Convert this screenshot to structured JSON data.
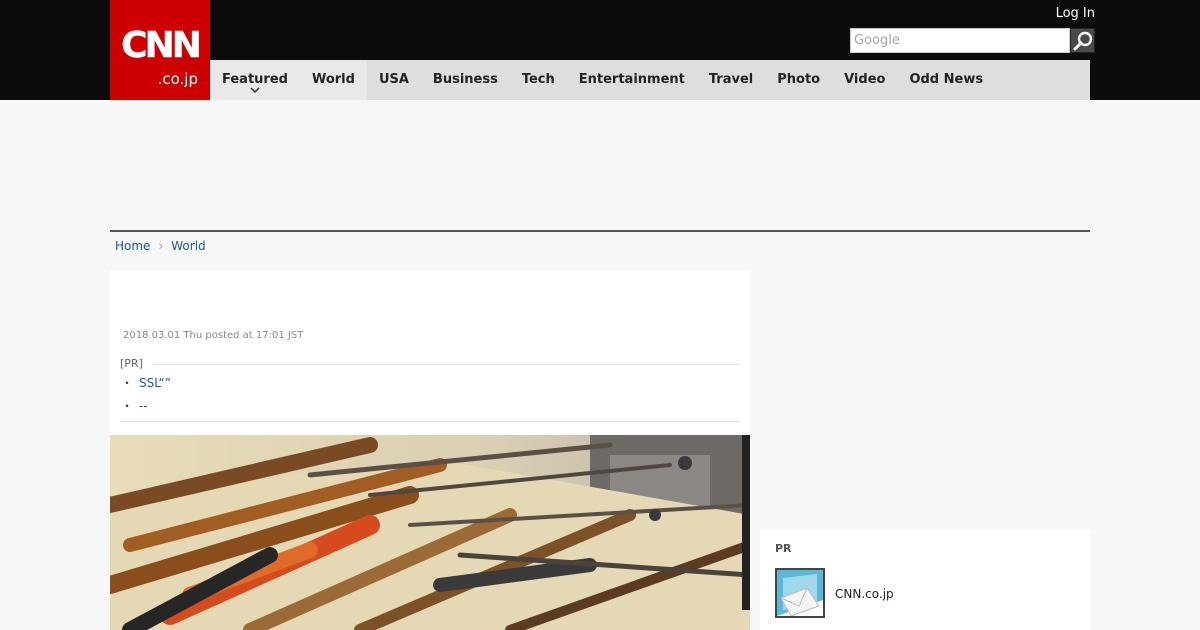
{
  "header": {
    "logo_main": "CNN",
    "logo_sub": ".co.jp",
    "login_label": "Log In",
    "search": {
      "placeholder": "Google"
    }
  },
  "nav": {
    "items": [
      {
        "label": "Featured"
      },
      {
        "label": "World"
      },
      {
        "label": "USA"
      },
      {
        "label": "Business"
      },
      {
        "label": "Tech"
      },
      {
        "label": "Entertainment"
      },
      {
        "label": "Travel"
      },
      {
        "label": "Photo"
      },
      {
        "label": "Video"
      },
      {
        "label": "Odd News"
      }
    ]
  },
  "breadcrumb": {
    "home": "Home",
    "current": "World"
  },
  "article": {
    "posted": "2018.03.01 Thu posted at 17:01 JST",
    "pr_label": "[PR]",
    "pr_links": [
      "SSL“”",
      "--"
    ]
  },
  "sidebar": {
    "pr_title": "PR",
    "pr_item": "CNN.co.jp"
  },
  "colors": {
    "brand_red": "#cc0000",
    "topbar": "#0c0c0c",
    "nav_bg": "#dedede",
    "link": "#1a5a96"
  }
}
